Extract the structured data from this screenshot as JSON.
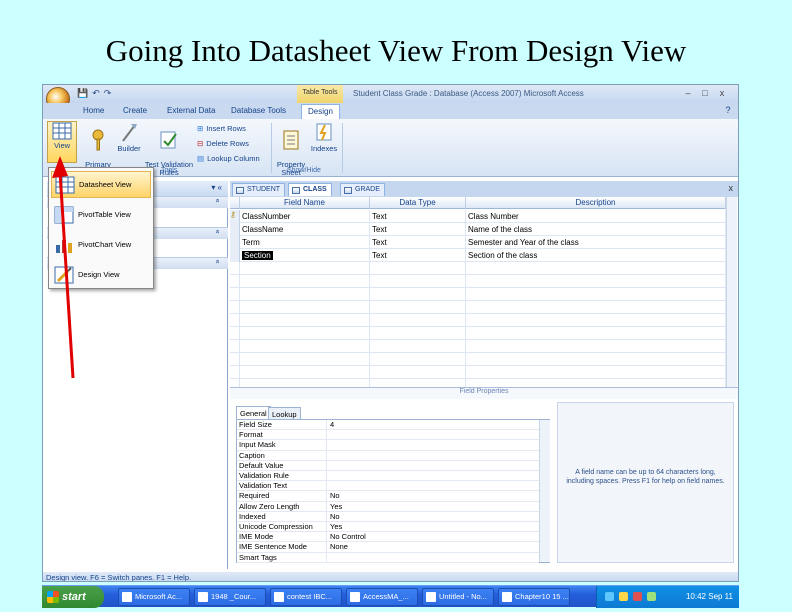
{
  "slide_title": "Going Into Datasheet View From Design View",
  "window": {
    "title": "Student Class Grade : Database (Access 2007)   Microsoft Access",
    "context_tab": "Table Tools",
    "min": "–",
    "max": "□",
    "close": "x",
    "help": "?"
  },
  "tabs": [
    "Home",
    "Create",
    "External Data",
    "Database Tools",
    "Design"
  ],
  "ribbon": {
    "view_label": "View",
    "primary_key": "Primary\nKey",
    "builder": "Builder",
    "test_validation": "Test Validation\nRules",
    "insert_rows": "Insert Rows",
    "delete_rows": "Delete Rows",
    "lookup_column": "Lookup Column",
    "property_sheet": "Property\nSheet",
    "indexes": "Indexes",
    "tools_group": "Tools",
    "showhide_group": "Show/Hide"
  },
  "view_menu": [
    {
      "label": "Datasheet View",
      "icon": "datasheet-view-icon"
    },
    {
      "label": "PivotTable View",
      "icon": "pivottable-view-icon"
    },
    {
      "label": "PivotChart View",
      "icon": "pivotchart-view-icon"
    },
    {
      "label": "Design View",
      "icon": "design-view-icon"
    }
  ],
  "nav_pane": {
    "header_arrows": "▾ «",
    "group_toggle": "»"
  },
  "doc_tabs": [
    "STUDENT",
    "CLASS",
    "GRADE"
  ],
  "grid": {
    "headers": [
      "Field Name",
      "Data Type",
      "Description"
    ],
    "rows": [
      {
        "field": "ClassNumber",
        "type": "Text",
        "desc": "Class Number"
      },
      {
        "field": "ClassName",
        "type": "Text",
        "desc": "Name of the class"
      },
      {
        "field": "Term",
        "type": "Text",
        "desc": "Semester and Year of the class"
      },
      {
        "field": "Section",
        "type": "Text",
        "desc": "Section of the class"
      }
    ]
  },
  "field_properties": {
    "label": "Field Properties",
    "tabs": [
      "General",
      "Lookup"
    ],
    "rows": [
      {
        "name": "Field Size",
        "value": "4"
      },
      {
        "name": "Format",
        "value": ""
      },
      {
        "name": "Input Mask",
        "value": ""
      },
      {
        "name": "Caption",
        "value": ""
      },
      {
        "name": "Default Value",
        "value": ""
      },
      {
        "name": "Validation Rule",
        "value": ""
      },
      {
        "name": "Validation Text",
        "value": ""
      },
      {
        "name": "Required",
        "value": "No"
      },
      {
        "name": "Allow Zero Length",
        "value": "Yes"
      },
      {
        "name": "Indexed",
        "value": "No"
      },
      {
        "name": "Unicode Compression",
        "value": "Yes"
      },
      {
        "name": "IME Mode",
        "value": "No Control"
      },
      {
        "name": "IME Sentence Mode",
        "value": "None"
      },
      {
        "name": "Smart Tags",
        "value": ""
      }
    ],
    "help": "A field name can be up to 64 characters long, including spaces. Press F1 for help on field names."
  },
  "status_bar": "Design view.  F6 = Switch panes.  F1 = Help.",
  "taskbar": {
    "start": "start",
    "buttons": [
      "Microsoft Ac...",
      "1948 _Cour...",
      "contest IBC...",
      "AccessMA_...",
      "Untitled - No...",
      "Chapter10 15 ..."
    ],
    "clock": "10:42 Sep 11"
  },
  "colors": {
    "slide_bg": "#ccffff",
    "arrow": "#e00000",
    "ribbon_accent": "#15428b"
  }
}
